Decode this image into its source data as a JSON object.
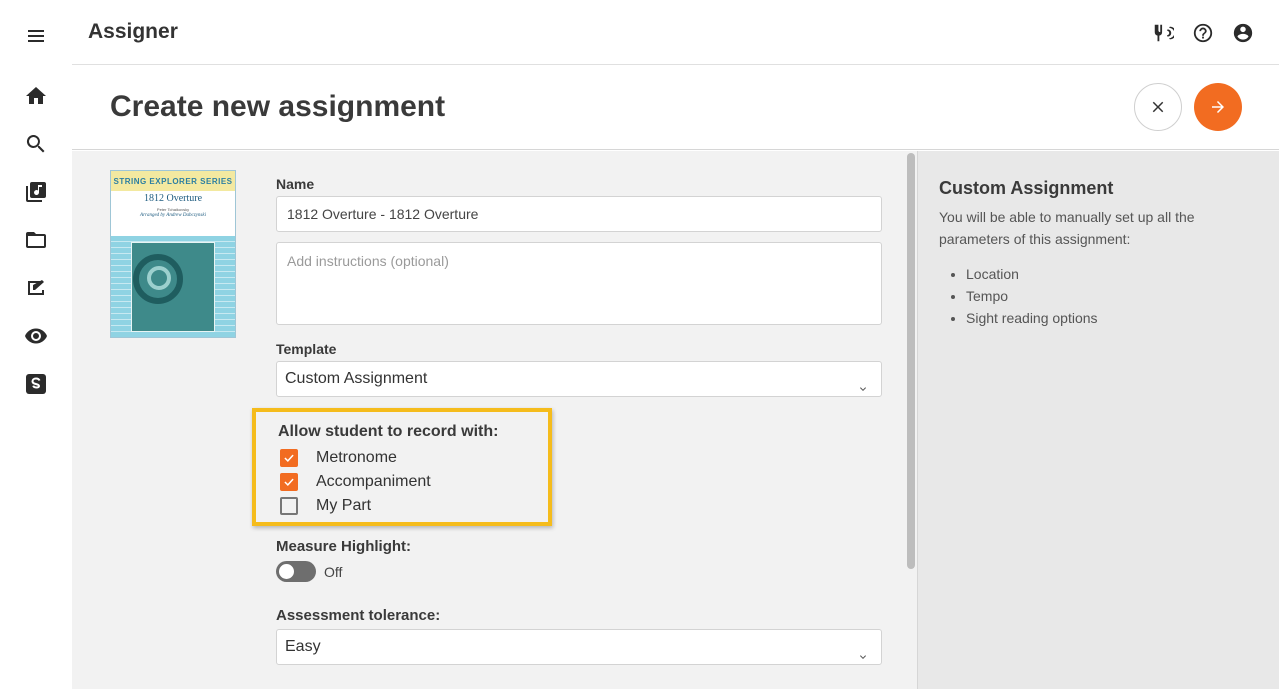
{
  "app": {
    "title": "Assigner"
  },
  "rail": {
    "items": [
      {
        "name": "menu-icon"
      },
      {
        "name": "home-icon"
      },
      {
        "name": "search-icon"
      },
      {
        "name": "music-library-icon"
      },
      {
        "name": "folder-icon"
      },
      {
        "name": "assignment-icon"
      },
      {
        "name": "eye-icon"
      },
      {
        "name": "s-logo-icon"
      }
    ]
  },
  "topbar_icons": [
    "tuner-icon",
    "help-icon",
    "account-icon"
  ],
  "header": {
    "page_title": "Create new assignment"
  },
  "cover": {
    "series": "STRING EXPLORER SERIES",
    "piece": "1812 Overture",
    "composer": "Peter Tchaikovsky",
    "arranger": "Arranged by Andrew Dabczynski"
  },
  "form": {
    "name_label": "Name",
    "name_value": "1812 Overture - 1812 Overture",
    "instructions_placeholder": "Add instructions (optional)",
    "template_label": "Template",
    "template_value": "Custom Assignment",
    "record_title": "Allow student to record with:",
    "record_options": [
      {
        "label": "Metronome",
        "checked": true
      },
      {
        "label": "Accompaniment",
        "checked": true
      },
      {
        "label": "My Part",
        "checked": false
      }
    ],
    "measure_label": "Measure Highlight:",
    "measure_state": "Off",
    "tolerance_label": "Assessment tolerance:",
    "tolerance_value": "Easy"
  },
  "side": {
    "title": "Custom Assignment",
    "description": "You will be able to manually set up all the parameters of this assignment:",
    "items": [
      "Location",
      "Tempo",
      "Sight reading options"
    ]
  },
  "colors": {
    "accent": "#f26c21",
    "highlight": "#f5bc1c"
  }
}
